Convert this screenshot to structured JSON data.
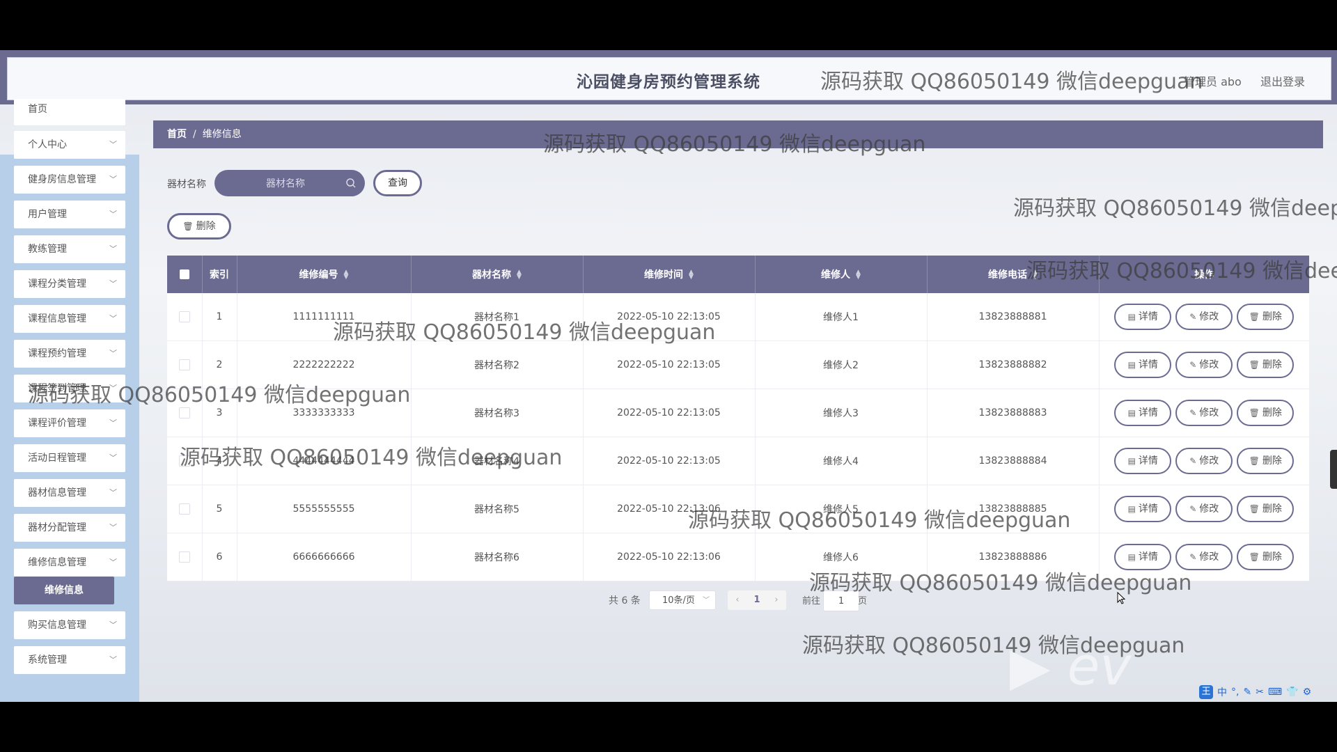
{
  "header": {
    "title": "沁园健身房预约管理系统",
    "admin": "管理员 abo",
    "logout": "退出登录"
  },
  "sidebar": {
    "items": [
      {
        "label": "首页"
      },
      {
        "label": "个人中心"
      },
      {
        "label": "健身房信息管理"
      },
      {
        "label": "用户管理"
      },
      {
        "label": "教练管理"
      },
      {
        "label": "课程分类管理"
      },
      {
        "label": "课程信息管理"
      },
      {
        "label": "课程预约管理"
      },
      {
        "label": "课程签到管理"
      },
      {
        "label": "课程评价管理"
      },
      {
        "label": "活动日程管理"
      },
      {
        "label": "器材信息管理"
      },
      {
        "label": "器材分配管理"
      },
      {
        "label": "维修信息管理"
      },
      {
        "label": "购买信息管理"
      },
      {
        "label": "系统管理"
      }
    ],
    "active_sub": "维修信息"
  },
  "breadcrumb": {
    "home": "首页",
    "current": "维修信息"
  },
  "search": {
    "label": "器材名称",
    "placeholder": "器材名称",
    "query_label": "查询"
  },
  "batch_delete_label": "删除",
  "table": {
    "headers": [
      "索引",
      "维修编号",
      "器材名称",
      "维修时间",
      "维修人",
      "维修电话",
      "操作"
    ],
    "rows": [
      {
        "index": "1",
        "code": "1111111111",
        "name": "器材名称1",
        "time": "2022-05-10 22:13:05",
        "person": "维修人1",
        "phone": "13823888881"
      },
      {
        "index": "2",
        "code": "2222222222",
        "name": "器材名称2",
        "time": "2022-05-10 22:13:05",
        "person": "维修人2",
        "phone": "13823888882"
      },
      {
        "index": "3",
        "code": "3333333333",
        "name": "器材名称3",
        "time": "2022-05-10 22:13:05",
        "person": "维修人3",
        "phone": "13823888883"
      },
      {
        "index": "4",
        "code": "4444444444",
        "name": "器材名称4",
        "time": "2022-05-10 22:13:05",
        "person": "维修人4",
        "phone": "13823888884"
      },
      {
        "index": "5",
        "code": "5555555555",
        "name": "器材名称5",
        "time": "2022-05-10 22:13:06",
        "person": "维修人5",
        "phone": "13823888885"
      },
      {
        "index": "6",
        "code": "6666666666",
        "name": "器材名称6",
        "time": "2022-05-10 22:13:06",
        "person": "维修人6",
        "phone": "13823888886"
      }
    ],
    "actions": {
      "detail": "详情",
      "edit": "修改",
      "delete": "删除"
    }
  },
  "pagination": {
    "total": "共 6 条",
    "page_size": "10条/页",
    "current_page": "1",
    "goto_label": "前往",
    "goto_value": "1",
    "page_suffix": "页"
  },
  "watermark": "源码获取 QQ86050149 微信deepguan",
  "ime": {
    "lang": "中"
  },
  "colors": {
    "primary": "#6b6b92",
    "sidebar": "#b7cfe8"
  }
}
